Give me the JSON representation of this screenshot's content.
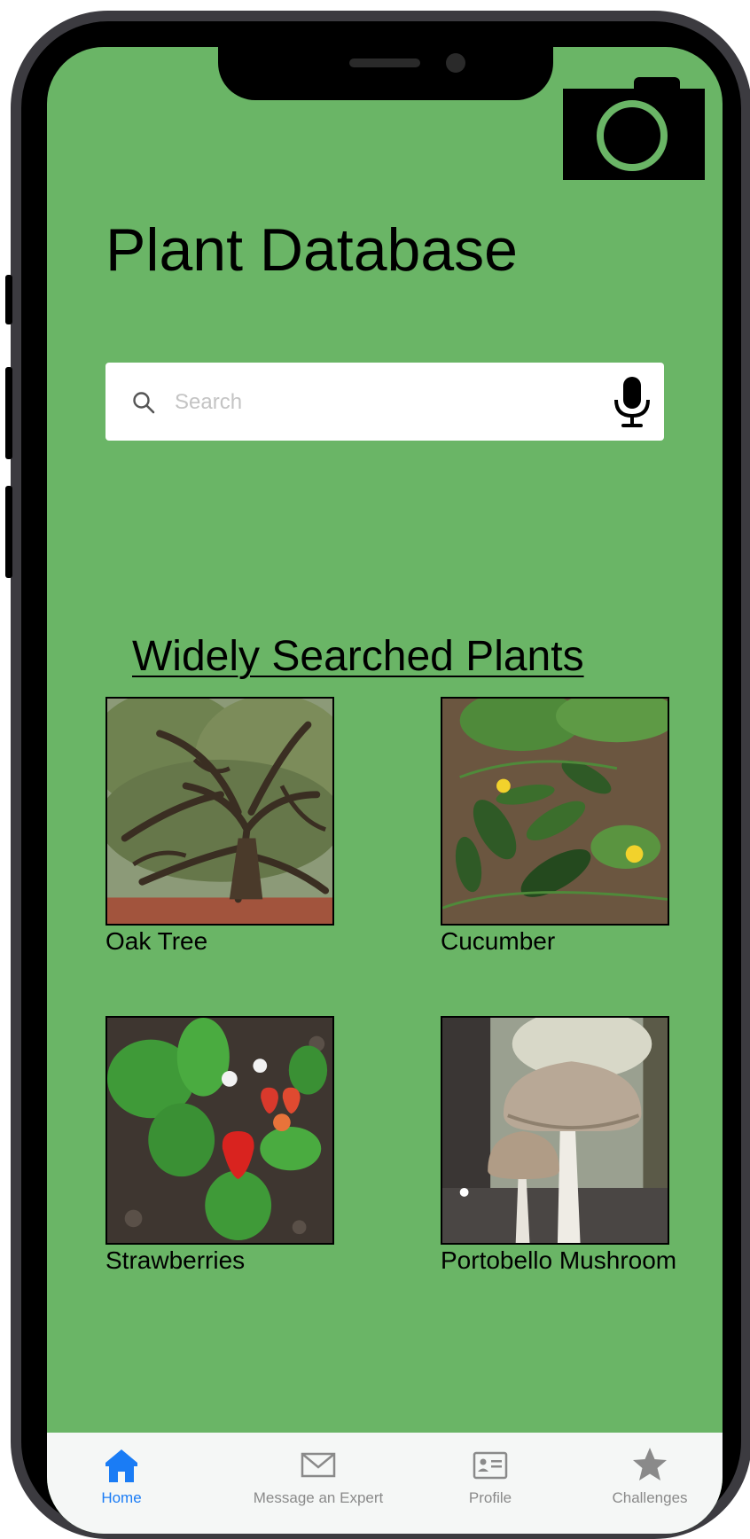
{
  "header": {
    "title": "Plant Database",
    "camera_icon": "camera-icon"
  },
  "search": {
    "placeholder": "Search",
    "value": "",
    "search_icon": "search-icon",
    "voice_icon": "microphone-icon"
  },
  "section": {
    "title": "Widely Searched Plants"
  },
  "plants": [
    {
      "name": "Oak Tree",
      "image": "oak-tree-photo"
    },
    {
      "name": "Cucumber",
      "image": "cucumber-photo"
    },
    {
      "name": "Strawberries",
      "image": "strawberries-photo"
    },
    {
      "name": "Portobello Mushroom",
      "image": "portobello-mushroom-photo"
    }
  ],
  "tabs": [
    {
      "label": "Home",
      "icon": "home-icon",
      "active": true
    },
    {
      "label": "Message an Expert",
      "icon": "envelope-icon",
      "active": false
    },
    {
      "label": "Profile",
      "icon": "id-card-icon",
      "active": false
    },
    {
      "label": "Challenges",
      "icon": "star-icon",
      "active": false
    }
  ],
  "colors": {
    "screen_background": "#6ab566",
    "active_tab": "#1a7cf5",
    "inactive_tab": "#8a8a8a",
    "tab_bar_background": "#f5f7f6"
  }
}
